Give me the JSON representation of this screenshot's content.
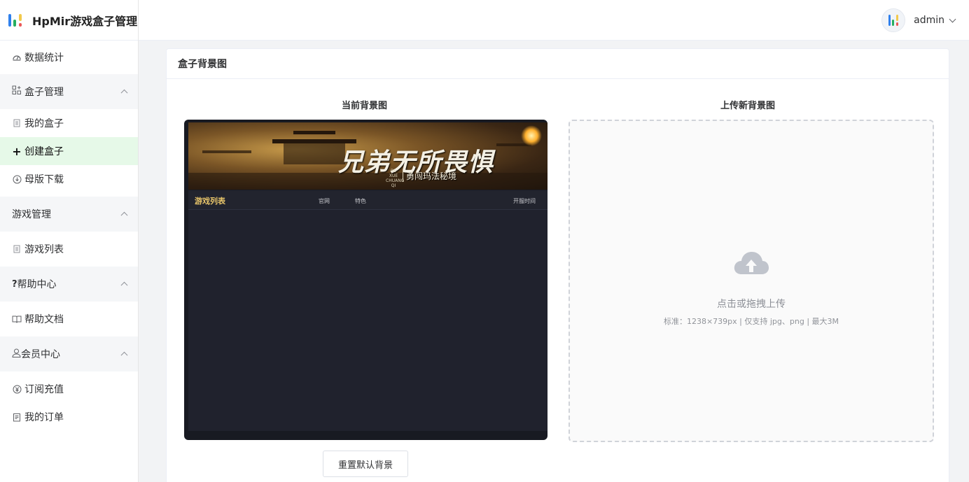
{
  "app": {
    "title": "HpMir游戏盒子管理",
    "logo_colors": [
      "#2f80ed",
      "#27ae60",
      "#f2c94c",
      "#eb5757"
    ]
  },
  "header": {
    "username": "admin"
  },
  "sidebar": {
    "items": [
      {
        "label": "数据统计",
        "icon": "dashboard-icon"
      },
      {
        "label": "盒子管理",
        "icon": "grid-plus-icon",
        "group": true
      },
      {
        "label": "我的盒子",
        "icon": "document-icon"
      },
      {
        "label": "创建盒子",
        "icon": "plus-icon",
        "active": true
      },
      {
        "label": "母版下载",
        "icon": "download-icon"
      },
      {
        "label": "游戏管理",
        "group": true
      },
      {
        "label": "游戏列表",
        "icon": "document-icon"
      },
      {
        "label": "帮助中心",
        "icon": "question-icon",
        "group": true
      },
      {
        "label": "帮助文档",
        "icon": "book-icon"
      },
      {
        "label": "会员中心",
        "icon": "user-icon",
        "group": true
      },
      {
        "label": "订阅充值",
        "icon": "yen-icon"
      },
      {
        "label": "我的订单",
        "icon": "order-icon"
      }
    ]
  },
  "card": {
    "title": "盒子背景图",
    "current_title": "当前背景图",
    "upload_title": "上传新背景图",
    "reset_label": "重置默认背景"
  },
  "preview": {
    "banner_title": "兄弟无所畏惧",
    "banner_sub": "勇闯玛法秘境",
    "banner_tag": "RE XUE CHUANG QI",
    "list_title": "游戏列表",
    "col_official": "官网",
    "col_feature": "特色",
    "col_time": "开服时间"
  },
  "upload": {
    "text": "点击或拖拽上传",
    "hint": "标准：1238×739px | 仅支持 jpg、png | 最大3M"
  },
  "colors": {
    "active_bg": "#e6f9e8",
    "accent_gold": "#e8c56a"
  }
}
